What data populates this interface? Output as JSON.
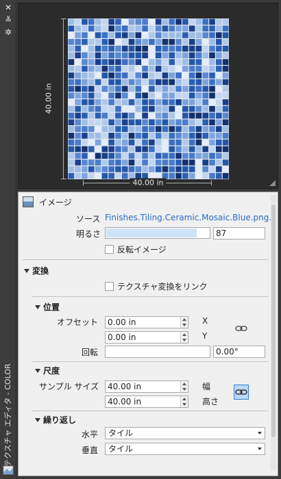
{
  "window": {
    "title": "テクスチャ エディタ - COLOR",
    "close_glyph": "✕",
    "autohide_glyph": "≚",
    "properties_glyph": "✲"
  },
  "preview": {
    "height_label": "40.00 in",
    "width_label": "40.00 in",
    "colors": [
      "#1a3f8a",
      "#2457a8",
      "#3b6fc2",
      "#5a88d0",
      "#7ea4dc",
      "#9ebde6",
      "#c3d6ef",
      "#e4edf8",
      "#14316e",
      "#4a7cc9",
      "#2c5fb4",
      "#b0c9ea"
    ]
  },
  "image_section": {
    "header": "イメージ",
    "source_label": "ソース",
    "source_value": "Finishes.Tiling.Ceramic.Mosaic.Blue.png.",
    "brightness_label": "明るさ",
    "brightness_value": "87",
    "brightness_level": 0.87,
    "invert_label": "反転イメージ"
  },
  "transform_section": {
    "header": "変換",
    "link_label": "テクスチャ変換をリンク"
  },
  "position_section": {
    "header": "位置",
    "offset_label": "オフセット",
    "offset_x": "0.00 in",
    "offset_y": "0.00 in",
    "x_label": "X",
    "y_label": "Y",
    "rotation_label": "回転",
    "rotation_value": "0.00°"
  },
  "scale_section": {
    "header": "尺度",
    "sample_size_label": "サンプル サイズ",
    "width_value": "40.00 in",
    "height_value": "40.00 in",
    "width_label": "幅",
    "height_label": "高さ"
  },
  "repeat_section": {
    "header": "繰り返し",
    "horizontal_label": "水平",
    "horizontal_value": "タイル",
    "vertical_label": "垂直",
    "vertical_value": "タイル"
  },
  "colors": {
    "accent": "#2f7bd8",
    "link": "#2b6cc4"
  }
}
